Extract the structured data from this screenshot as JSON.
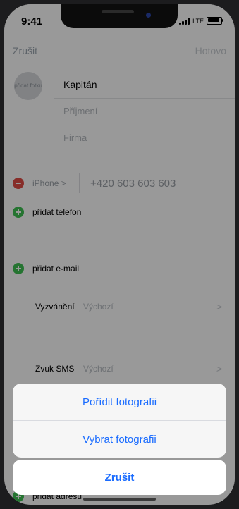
{
  "status_bar": {
    "time": "9:41",
    "network": "LTE"
  },
  "nav": {
    "cancel": "Zrušit",
    "done": "Hotovo"
  },
  "photo_placeholder": "přidat fotku",
  "fields": {
    "first_name": "Kapitán",
    "last_name_placeholder": "Příjmení",
    "company_placeholder": "Firma"
  },
  "phone_row": {
    "label": "iPhone",
    "chevron": ">",
    "number": "+420 603 603 603"
  },
  "actions": {
    "add_phone": "přidat telefon",
    "add_email": "přidat e-mail",
    "add_address": "přidat adresu"
  },
  "settings": [
    {
      "key": "Vyzvánění",
      "value": "Výchozí",
      "chevron": ">"
    },
    {
      "key": "Zvuk SMS",
      "value": "Výchozí",
      "chevron": ">"
    }
  ],
  "action_sheet": {
    "take_photo": "Pořídit fotografii",
    "choose_photo": "Vybrat fotografii",
    "cancel": "Zrušit"
  },
  "colors": {
    "accent": "#1a6cff",
    "add_green": "#3fc152",
    "remove_red": "#e24b45"
  }
}
